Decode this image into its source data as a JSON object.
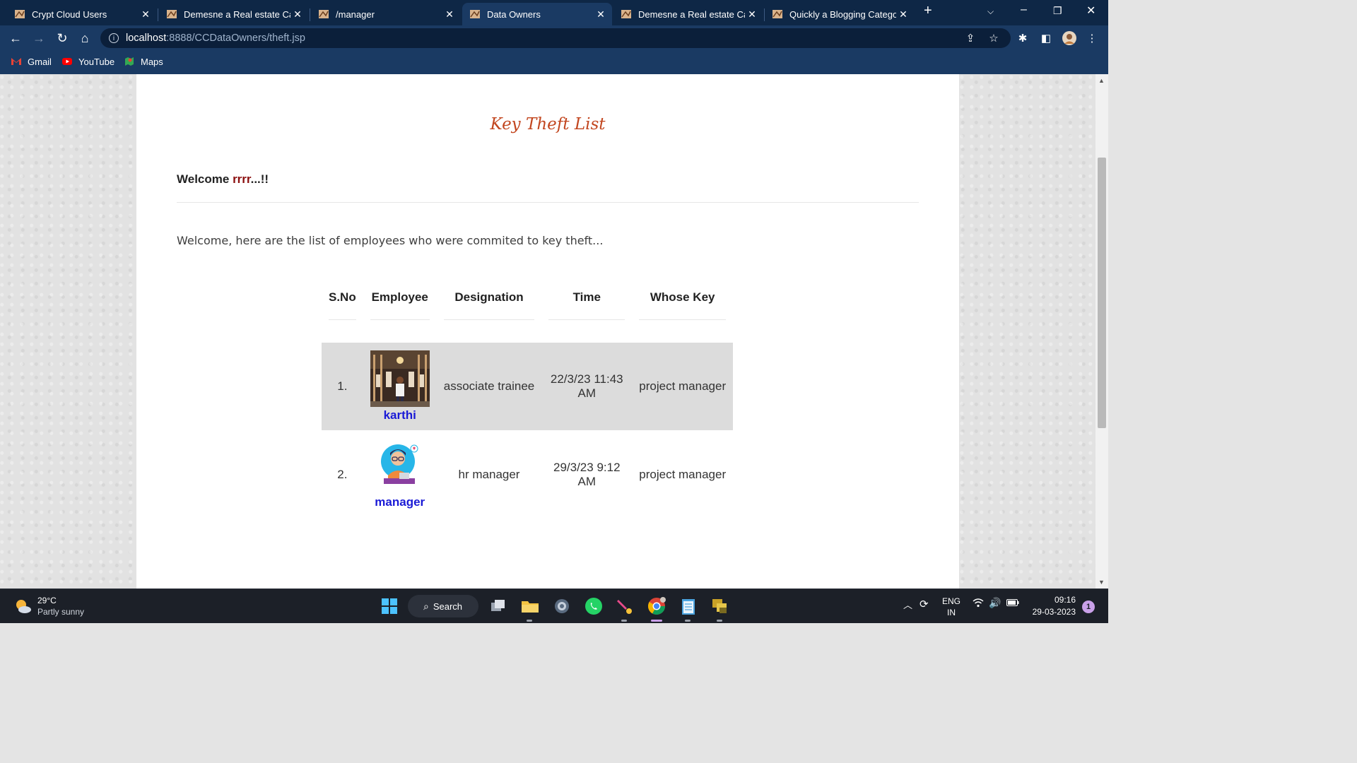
{
  "browser": {
    "tabs": [
      {
        "title": "Crypt Cloud Users",
        "active": false
      },
      {
        "title": "Demesne a Real estate Cate",
        "active": false
      },
      {
        "title": "/manager",
        "active": false
      },
      {
        "title": "Data Owners",
        "active": true
      },
      {
        "title": "Demesne a Real estate Cate",
        "active": false
      },
      {
        "title": "Quickly a Blogging Categor",
        "active": false
      }
    ],
    "url_host": "localhost",
    "url_rest": ":8888/CCDataOwners/theft.jsp",
    "bookmarks": [
      {
        "label": "Gmail",
        "icon": "gmail-icon"
      },
      {
        "label": "YouTube",
        "icon": "youtube-icon"
      },
      {
        "label": "Maps",
        "icon": "maps-icon"
      }
    ]
  },
  "page": {
    "heading": "Key Theft List",
    "welcome_prefix": "Welcome ",
    "username": "rrrr",
    "welcome_suffix": "...!!",
    "intro": "Welcome, here are the list of employees who were commited to key theft...",
    "table": {
      "headers": [
        "S.No",
        "Employee",
        "Designation",
        "Time",
        "Whose Key"
      ],
      "rows": [
        {
          "sno": "1.",
          "employee": "karthi",
          "designation": "associate trainee",
          "time": "22/3/23 11:43 AM",
          "whose_key": "project manager"
        },
        {
          "sno": "2.",
          "employee": "manager",
          "designation": "hr manager",
          "time": "29/3/23 9:12 AM",
          "whose_key": "project manager"
        }
      ]
    }
  },
  "taskbar": {
    "temperature": "29°C",
    "weather": "Partly sunny",
    "search_label": "Search",
    "lang": "ENG",
    "region": "IN",
    "time": "09:16",
    "date": "29-03-2023",
    "notification_count": "1"
  }
}
